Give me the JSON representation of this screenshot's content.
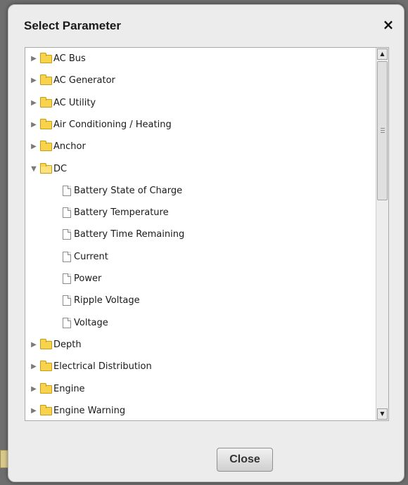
{
  "dialog": {
    "title": "Select Parameter",
    "close_icon": "×",
    "close_button_label": "Close"
  },
  "tree": {
    "items": [
      {
        "label": "AC Bus",
        "type": "folder",
        "expanded": false,
        "depth": 0
      },
      {
        "label": "AC Generator",
        "type": "folder",
        "expanded": false,
        "depth": 0
      },
      {
        "label": "AC Utility",
        "type": "folder",
        "expanded": false,
        "depth": 0
      },
      {
        "label": "Air Conditioning / Heating",
        "type": "folder",
        "expanded": false,
        "depth": 0
      },
      {
        "label": "Anchor",
        "type": "folder",
        "expanded": false,
        "depth": 0
      },
      {
        "label": "DC",
        "type": "folder",
        "expanded": true,
        "depth": 0
      },
      {
        "label": "Battery State of Charge",
        "type": "file",
        "depth": 1
      },
      {
        "label": "Battery Temperature",
        "type": "file",
        "depth": 1
      },
      {
        "label": "Battery Time Remaining",
        "type": "file",
        "depth": 1
      },
      {
        "label": "Current",
        "type": "file",
        "depth": 1
      },
      {
        "label": "Power",
        "type": "file",
        "depth": 1
      },
      {
        "label": "Ripple Voltage",
        "type": "file",
        "depth": 1
      },
      {
        "label": "Voltage",
        "type": "file",
        "depth": 1
      },
      {
        "label": "Depth",
        "type": "folder",
        "expanded": false,
        "depth": 0
      },
      {
        "label": "Electrical Distribution",
        "type": "folder",
        "expanded": false,
        "depth": 0
      },
      {
        "label": "Engine",
        "type": "folder",
        "expanded": false,
        "depth": 0
      },
      {
        "label": "Engine Warning",
        "type": "folder",
        "expanded": false,
        "depth": 0
      }
    ]
  },
  "scrollbar": {
    "up_icon": "up-arrow-icon",
    "down_icon": "down-arrow-icon",
    "thumb_position_fraction": 0.0
  }
}
